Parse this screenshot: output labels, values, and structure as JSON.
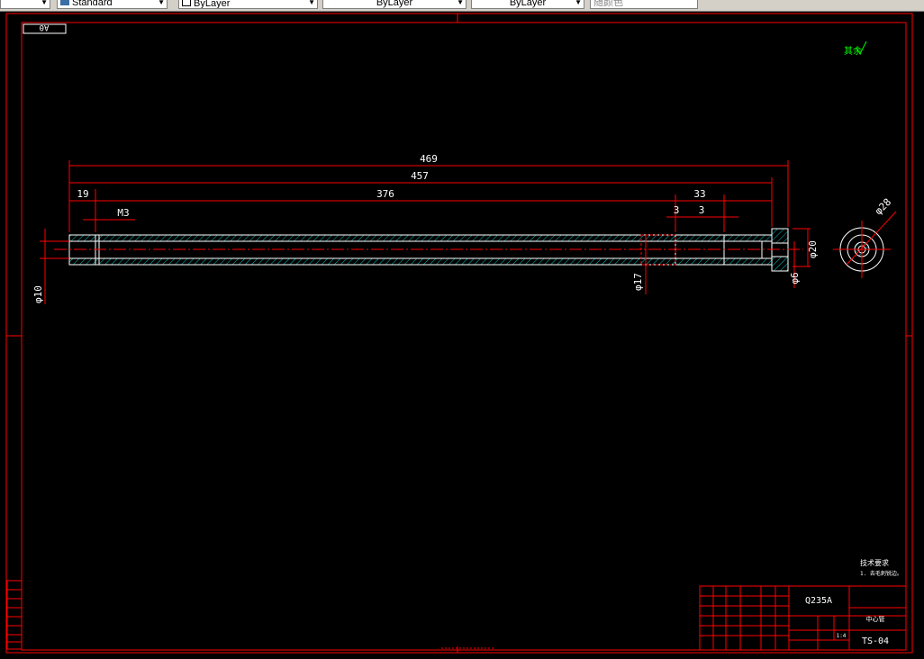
{
  "toolbar": {
    "dropdown_left": "",
    "text_style": "Standard",
    "layer_1": "ByLayer",
    "layer_2": "ByLayer",
    "layer_3": "ByLayer",
    "color": "随颜色"
  },
  "drawing": {
    "sheet_label": "A0",
    "roughness_mark": "其余",
    "dims": {
      "d469": "469",
      "d457": "457",
      "d19": "19",
      "d376": "376",
      "d33": "33",
      "d3a": "3",
      "d3b": "3",
      "m3": "M3",
      "phi10": "φ10",
      "phi17": "φ17",
      "phi20": "φ20",
      "phi6": "φ6",
      "phi28": "φ28"
    },
    "tech_req_title": "技术要求",
    "tech_req_item": "1. 去毛刺锐边。",
    "title_block": {
      "material": "Q235A",
      "part_name": "中心管",
      "drawing_no": "TS-04",
      "scale": "1:4"
    }
  },
  "colors": {
    "frame": "#ff0000",
    "geometry": "#ffffff",
    "hatch": "#00c0c0",
    "note": "#00ff00",
    "toolbar_bg": "#d4d0c8"
  }
}
